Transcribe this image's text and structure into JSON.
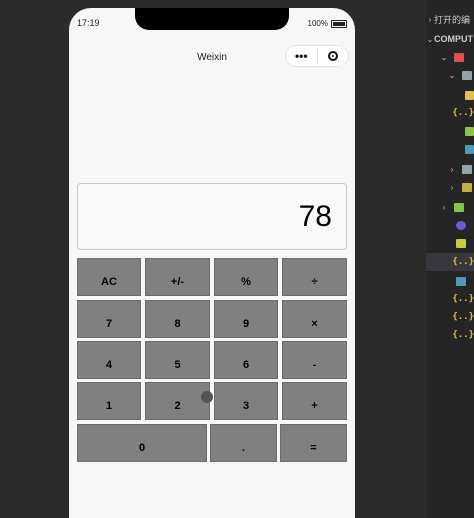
{
  "phone": {
    "status_time": "17:19",
    "battery": "100%",
    "nav_title": "Weixin",
    "more_label": "•••"
  },
  "calculator": {
    "display": "78",
    "keys": {
      "ac": "AC",
      "sign": "+/-",
      "percent": "%",
      "divide": "÷",
      "n7": "7",
      "n8": "8",
      "n9": "9",
      "multiply": "×",
      "n4": "4",
      "n5": "5",
      "n6": "6",
      "minus": "-",
      "n1": "1",
      "n2": "2",
      "n3": "3",
      "plus": "+",
      "n0": "0",
      "dot": ".",
      "equals": "="
    }
  },
  "ide": {
    "open_editors": "打开的编",
    "project": "COMPUT",
    "json_glyph": "{..}"
  },
  "colors": {
    "key_bg": "#808080",
    "page_bg": "#f7f7f7",
    "ide_bg": "#252526",
    "folder": "#c09553",
    "json": "#e2c04a",
    "css": "#519aba",
    "js": "#cbcb41"
  }
}
